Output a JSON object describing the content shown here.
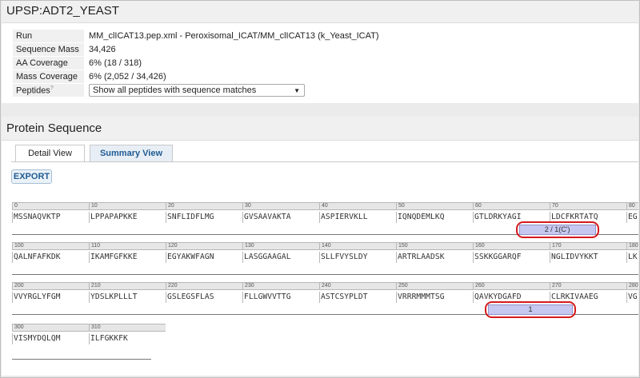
{
  "protein": {
    "title": "UPSP:ADT2_YEAST"
  },
  "properties": [
    {
      "key": "Run",
      "value": "MM_clICAT13.pep.xml - Peroxisomal_ICAT/MM_clICAT13 (k_Yeast_ICAT)"
    },
    {
      "key": "Sequence Mass",
      "value": "34,426"
    },
    {
      "key": "AA Coverage",
      "value": "6% (18 / 318)"
    },
    {
      "key": "Mass Coverage",
      "value": "6% (2,052 / 34,426)"
    }
  ],
  "peptides": {
    "label": "Peptides",
    "help": "?",
    "selected": "Show all peptides with sequence matches"
  },
  "sequence_section": {
    "title": "Protein Sequence",
    "tabs": {
      "detail": "Detail View",
      "summary": "Summary View"
    },
    "export_label": "EXPORT"
  },
  "sequence_rows": [
    {
      "indices": [
        "0",
        "10",
        "20",
        "30",
        "40",
        "50",
        "60",
        "70",
        "80"
      ],
      "segments": [
        "MSSNAQVKTP",
        "LPPAPAPKKE",
        "SNFLIDFLMG",
        "GVSAAVAKTA",
        "ASPIERVKLL",
        "IQNQDEMLKQ",
        "GTLDRKYAGI",
        "LDCFKRTATQ",
        "EG"
      ]
    },
    {
      "indices": [
        "100",
        "110",
        "120",
        "130",
        "140",
        "150",
        "160",
        "170",
        "180"
      ],
      "segments": [
        "QALNFAFKDK",
        "IKAMFGFKKE",
        "EGYAKWFAGN",
        "LASGGAAGAL",
        "SLLFVYSLDY",
        "ARTRLAADSK",
        "SSKKGGARQF",
        "NGLIDVYKKT",
        "LK"
      ]
    },
    {
      "indices": [
        "200",
        "210",
        "220",
        "230",
        "240",
        "250",
        "260",
        "270",
        "280"
      ],
      "segments": [
        "VVYRGLYFGM",
        "YDSLKPLLLT",
        "GSLEGSFLAS",
        "FLLGWVVTTG",
        "ASTCSYPLDT",
        "VRRRMMMTSG",
        "QAVKYDGAFD",
        "CLRKIVAAEG",
        "VG"
      ]
    },
    {
      "indices": [
        "300",
        "310"
      ],
      "segments": [
        "VISMYDQLQM",
        "ILFGKKFK"
      ]
    }
  ],
  "peptide_matches": [
    {
      "label": "2 / 1(C')",
      "start": 66,
      "end": 76,
      "row": 0
    },
    {
      "label": "1",
      "start": 262,
      "end": 273,
      "row": 2
    }
  ],
  "colors": {
    "highlight_circle": "#d61a1a",
    "peptide_fill": "#c7c8f0",
    "link": "#1f5b93"
  }
}
